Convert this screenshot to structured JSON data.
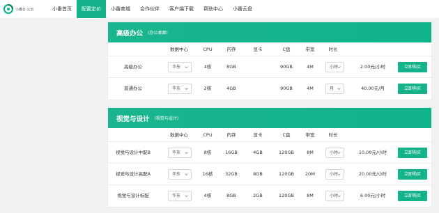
{
  "brand": {
    "name": "小番云·公云",
    "logo_icon": "cloud-logo-icon",
    "accent": "#13b28a"
  },
  "nav": [
    {
      "label": "小番首页"
    },
    {
      "label": "配置定价",
      "active": true
    },
    {
      "label": "小番商城"
    },
    {
      "label": "合作伙伴"
    },
    {
      "label": "客户端下载"
    },
    {
      "label": "帮助中心"
    },
    {
      "label": "小番云盘"
    }
  ],
  "columns": [
    "数据中心",
    "CPU",
    "内存",
    "显卡",
    "C盘",
    "带宽",
    "时长"
  ],
  "sections": [
    {
      "title": "高级办公",
      "subtitle": "(办公桌面)",
      "rows": [
        {
          "name": "高级办公",
          "dc": "华东",
          "cpu": "4核",
          "mem": "8GB",
          "gpu": "",
          "disk": "90GB",
          "bw": "4M",
          "dur": "小时",
          "price": "2.00元/小时",
          "buy": "立即购买"
        },
        {
          "name": "普通办公",
          "dc": "华东",
          "cpu": "2核",
          "mem": "4GB",
          "gpu": "",
          "disk": "90GB",
          "bw": "4M",
          "dur": "月",
          "price": "40.00元/月",
          "buy": "立即购买"
        }
      ]
    },
    {
      "title": "视觉与设计",
      "subtitle": "(视觉与设计)",
      "rows": [
        {
          "name": "视觉与设计中配B",
          "dc": "华东",
          "cpu": "8核",
          "mem": "16GB",
          "gpu": "4GB",
          "disk": "120GB",
          "bw": "8M",
          "dur": "小时",
          "price": "10.00元/小时",
          "buy": "立即购买"
        },
        {
          "name": "视觉与设计高配A",
          "dc": "华东",
          "cpu": "16核",
          "mem": "32GB",
          "gpu": "8GB",
          "disk": "120GB",
          "bw": "20M",
          "dur": "小时",
          "price": "20.00元/小时",
          "buy": "立即购买"
        },
        {
          "name": "视觉与设计标配",
          "dc": "华东",
          "cpu": "4核",
          "mem": "8GB",
          "gpu": "2GB",
          "disk": "120GB",
          "bw": "8M",
          "dur": "小时",
          "price": "6.00元/小时",
          "buy": "立即购买"
        }
      ]
    }
  ]
}
